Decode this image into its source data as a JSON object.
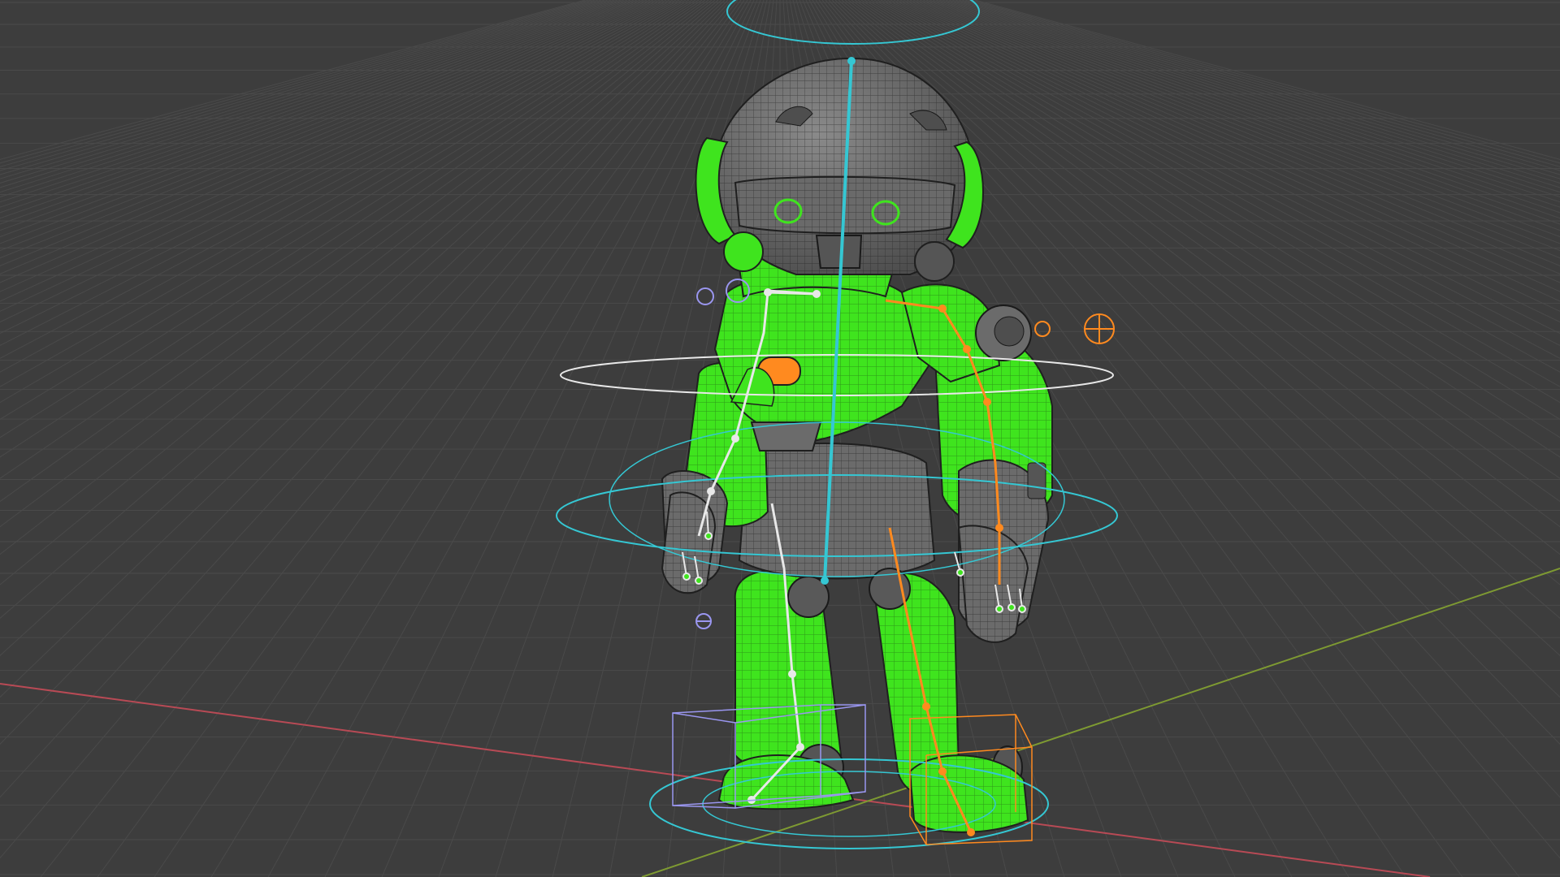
{
  "viewport": {
    "mode": "3d-viewport",
    "shading": "wireframe-overlay",
    "background_color": "#3d3d3d"
  },
  "colors": {
    "grid_line": "#4a4a4a",
    "x_axis": "#b84a55",
    "y_axis": "#7e9a32",
    "mesh_green": "#3fe41e",
    "mesh_gray": "#6b6b6b",
    "wire": "#1f1f1f",
    "control_cyan": "#35c7d3",
    "bone_white": "#e8e8e8",
    "bone_orange": "#ff8a1f",
    "ik_lavender": "#9a96f0"
  },
  "scene": {
    "object": "robot-character",
    "rig": "armature-with-ik-controls"
  }
}
